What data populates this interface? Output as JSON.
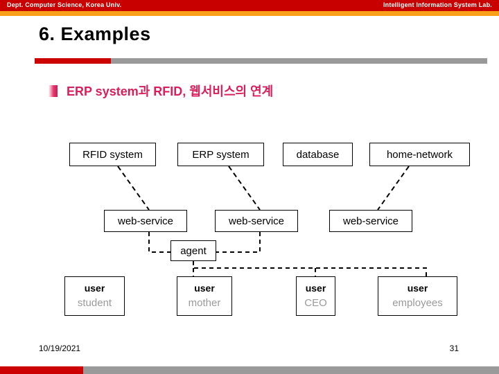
{
  "header": {
    "left_text": "Dept. Computer Science, Korea Univ.",
    "right_text": "Intelligent Information System Lab.",
    "band_red": "#c80000",
    "band_orange": "#f9a01b"
  },
  "slide": {
    "title": "6. Examples",
    "title_rule_accent_color": "#cc0000",
    "title_rule_color": "#999999"
  },
  "bullet": {
    "text": "ERP system과 RFID, 웹서비스의 연계",
    "color": "#d81e5b"
  },
  "diagram": {
    "systems": [
      {
        "label": "RFID system"
      },
      {
        "label": "ERP system"
      },
      {
        "label": "database"
      },
      {
        "label": "home-network"
      }
    ],
    "services": [
      {
        "label": "web-service"
      },
      {
        "label": "web-service"
      },
      {
        "label": "web-service"
      }
    ],
    "agent": {
      "label": "agent"
    },
    "users": [
      {
        "title": "user",
        "role": "student"
      },
      {
        "title": "user",
        "role": "mother"
      },
      {
        "title": "user",
        "role": "CEO"
      },
      {
        "title": "user",
        "role": "employees"
      }
    ]
  },
  "footer": {
    "date": "10/19/2021",
    "page_number": "31",
    "rule_accent_color": "#cc0000",
    "rule_color": "#9a9a9a"
  }
}
